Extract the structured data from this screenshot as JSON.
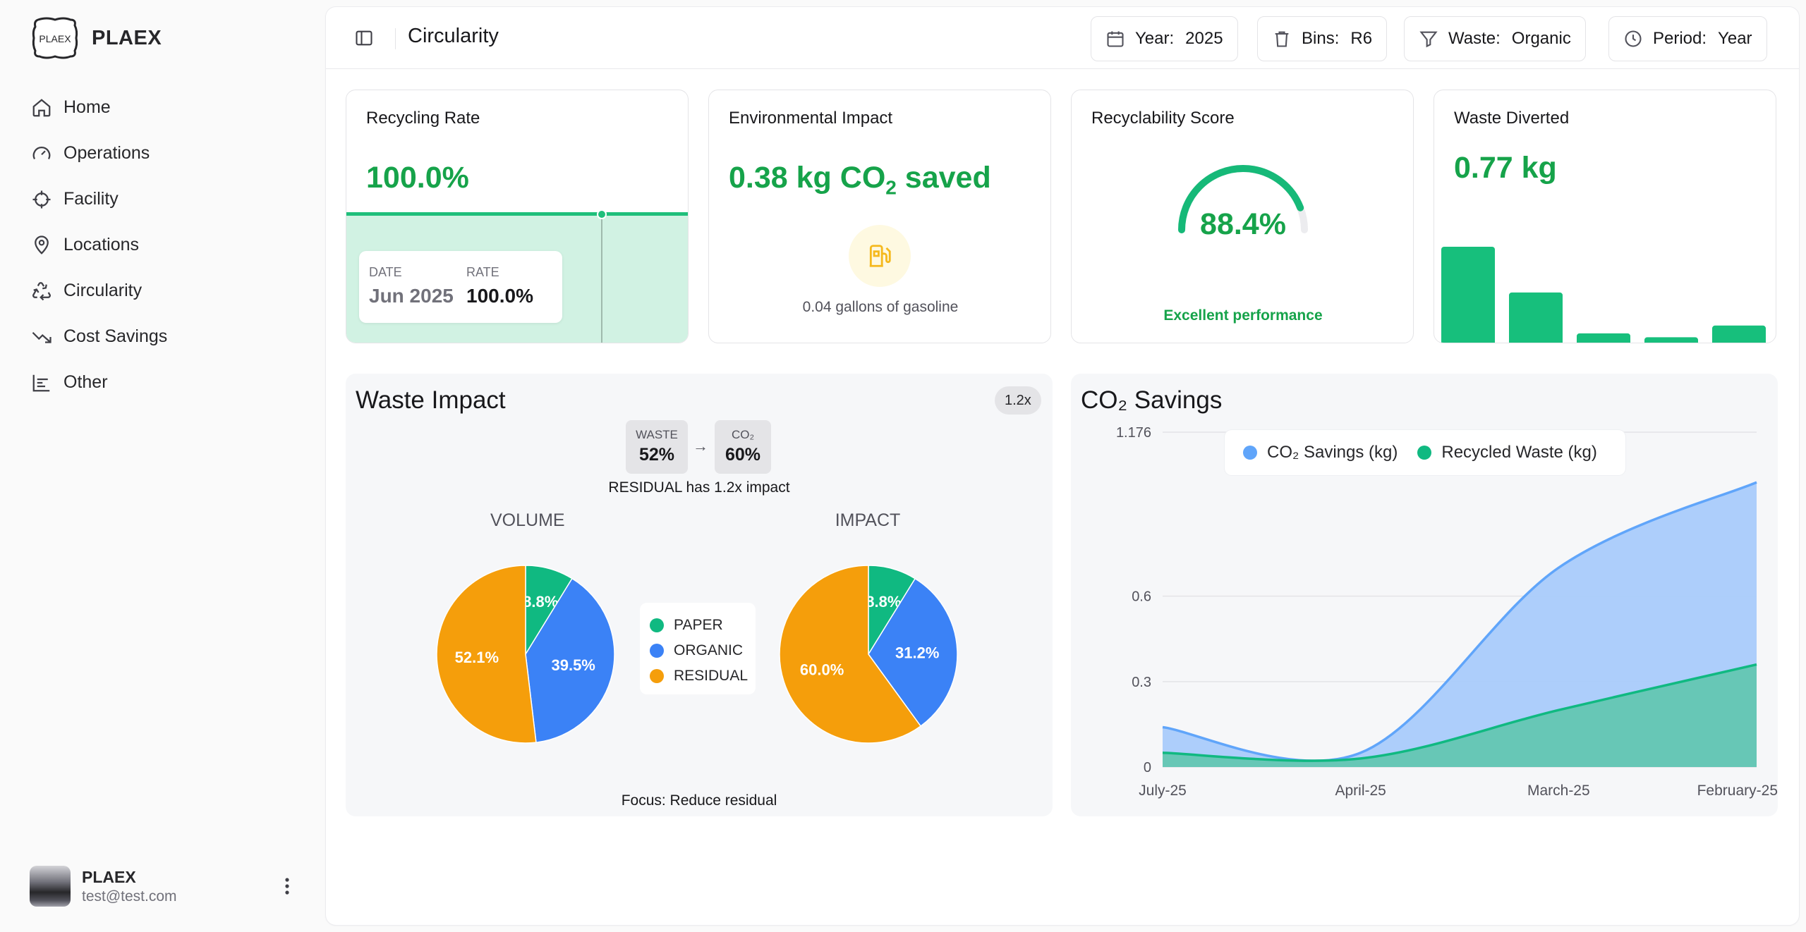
{
  "brand": {
    "name": "PLAEX",
    "logo_text": "PLAEX"
  },
  "nav": [
    {
      "label": "Home",
      "icon": "home-icon"
    },
    {
      "label": "Operations",
      "icon": "gauge-icon"
    },
    {
      "label": "Facility",
      "icon": "crosshair-icon"
    },
    {
      "label": "Locations",
      "icon": "map-pin-icon"
    },
    {
      "label": "Circularity",
      "icon": "recycle-icon"
    },
    {
      "label": "Cost Savings",
      "icon": "trending-down-icon"
    },
    {
      "label": "Other",
      "icon": "bar-chart-icon"
    }
  ],
  "user": {
    "name": "PLAEX",
    "email": "test@test.com"
  },
  "page": {
    "title": "Circularity"
  },
  "filters": {
    "year": {
      "key": "Year:",
      "value": "2025"
    },
    "bins": {
      "key": "Bins:",
      "value": "R6"
    },
    "waste": {
      "key": "Waste:",
      "value": "Organic"
    },
    "period": {
      "key": "Period:",
      "value": "Year"
    }
  },
  "kpis": {
    "recycling": {
      "title": "Recycling Rate",
      "value": "100.0%",
      "tooltip": {
        "date_label": "DATE",
        "date": "Jun 2025",
        "rate_label": "RATE",
        "rate": "100.0%"
      }
    },
    "environmental": {
      "title": "Environmental Impact",
      "value_prefix": "0.38 kg CO",
      "value_sub": "2",
      "value_suffix": " saved",
      "caption": "0.04 gallons of gasoline"
    },
    "recyclability": {
      "title": "Recyclability Score",
      "value": "88.4%",
      "score": 0.884,
      "caption": "Excellent performance"
    },
    "diverted": {
      "title": "Waste Diverted",
      "value": "0.77 kg",
      "bars": [
        1.0,
        0.53,
        0.11,
        0.07,
        0.19
      ]
    }
  },
  "waste_impact": {
    "title": "Waste Impact",
    "badge": "1.2x",
    "waste_label": "WASTE",
    "waste_value": "52%",
    "co2_label": "CO₂",
    "co2_value": "60%",
    "arrow": "→",
    "note": "RESIDUAL has 1.2x impact",
    "volume_label": "VOLUME",
    "impact_label": "IMPACT",
    "focus": "Focus: Reduce residual",
    "legend": [
      {
        "label": "PAPER",
        "color": "#10b981"
      },
      {
        "label": "ORGANIC",
        "color": "#3b82f6"
      },
      {
        "label": "RESIDUAL",
        "color": "#f59e0b"
      }
    ]
  },
  "co2_savings": {
    "title": "CO₂ Savings",
    "legend": [
      {
        "label": "CO₂ Savings (kg)",
        "color": "#60a5fa"
      },
      {
        "label": "Recycled Waste (kg)",
        "color": "#10b981"
      }
    ]
  },
  "chart_data": [
    {
      "type": "pie",
      "title": "VOLUME",
      "categories": [
        "PAPER",
        "ORGANIC",
        "RESIDUAL"
      ],
      "values": [
        8.8,
        39.5,
        52.1
      ],
      "labels": [
        "8.8%",
        "39.5%",
        "52.1%"
      ],
      "colors": [
        "#10b981",
        "#3b82f6",
        "#f59e0b"
      ]
    },
    {
      "type": "pie",
      "title": "IMPACT",
      "categories": [
        "PAPER",
        "ORGANIC",
        "RESIDUAL"
      ],
      "values": [
        8.8,
        31.2,
        60.0
      ],
      "labels": [
        "8.8%",
        "31.2%",
        "60.0%"
      ],
      "colors": [
        "#10b981",
        "#3b82f6",
        "#f59e0b"
      ]
    },
    {
      "type": "area",
      "title": "CO₂ Savings",
      "x": [
        "July-25",
        "April-25",
        "March-25",
        "February-25"
      ],
      "xticks": [
        "July-25",
        "April-25",
        "March-25",
        "February-25"
      ],
      "yticks": [
        "1.176",
        "0.6",
        "0.3",
        "0"
      ],
      "ylim": [
        0,
        1.176
      ],
      "series": [
        {
          "name": "CO₂ Savings (kg)",
          "values": [
            0.14,
            0.05,
            0.7,
            1.0
          ],
          "color": "#60a5fa"
        },
        {
          "name": "Recycled Waste (kg)",
          "values": [
            0.05,
            0.03,
            0.2,
            0.36
          ],
          "color": "#10b981"
        }
      ]
    }
  ]
}
